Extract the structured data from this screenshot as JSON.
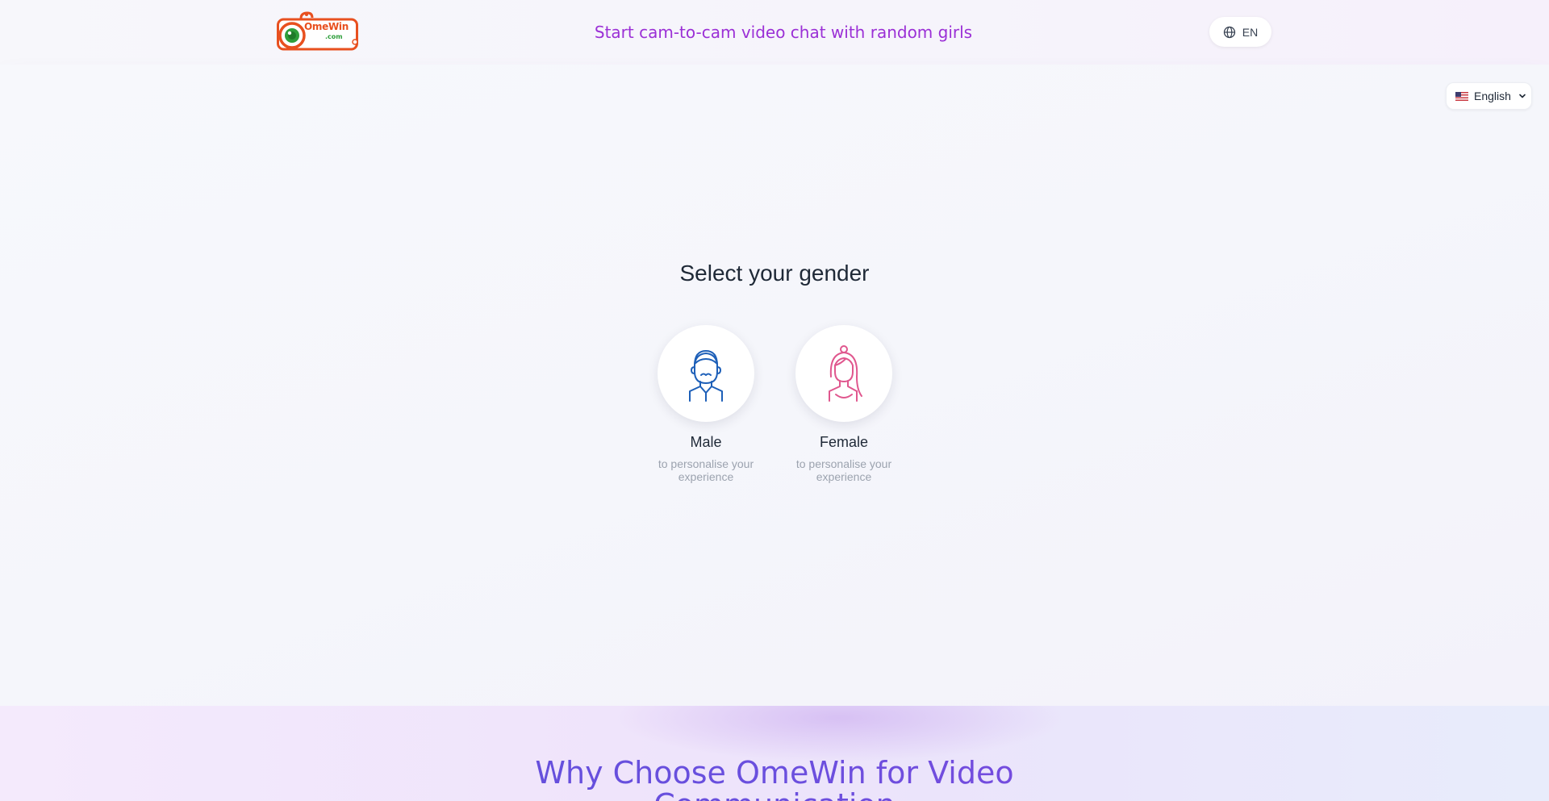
{
  "header": {
    "logo": {
      "text": "OmeWin",
      "sub": ".com"
    },
    "tagline": "Start cam-to-cam video chat with random girls",
    "lang_pill": "EN"
  },
  "main": {
    "language_select": {
      "selected": "English",
      "flag": "us-flag"
    },
    "title": "Select your gender",
    "options": [
      {
        "label": "Male",
        "sub": "to personalise your experience",
        "icon": "male-avatar-icon",
        "color": "#1d5fb8"
      },
      {
        "label": "Female",
        "sub": "to personalise your experience",
        "icon": "female-avatar-icon",
        "color": "#e0578e"
      }
    ]
  },
  "bottom": {
    "title": "Why Choose OmeWin for Video Communication"
  },
  "colors": {
    "tagline": "#9b30d6",
    "logo_orange": "#e8501f",
    "logo_green": "#2e9e3b",
    "why_title_start": "#5b4fd9",
    "why_title_end": "#8a45dd"
  }
}
